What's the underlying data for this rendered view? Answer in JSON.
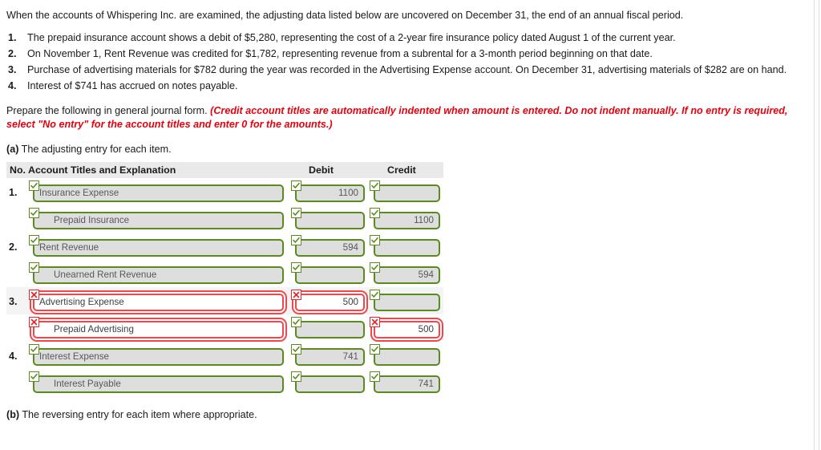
{
  "intro": "When the accounts of Whispering Inc. are examined, the adjusting data listed below are uncovered on December 31, the end of an annual fiscal period.",
  "facts": [
    {
      "num": "1.",
      "text": "The prepaid insurance account shows a debit of $5,280, representing the cost of a 2-year fire insurance policy dated August 1 of the current year."
    },
    {
      "num": "2.",
      "text": "On November 1, Rent Revenue was credited for $1,782, representing revenue from a subrental for a 3-month period beginning on that date."
    },
    {
      "num": "3.",
      "text": "Purchase of advertising materials for $782 during the year was recorded in the Advertising Expense account. On December 31, advertising materials of $282 are on hand."
    },
    {
      "num": "4.",
      "text": "Interest of $741 has accrued on notes payable."
    }
  ],
  "prepare": {
    "lead": "Prepare the following in general journal form. ",
    "emphasis": "(Credit account titles are automatically indented when amount is entered. Do not indent manually. If no entry is required, select \"No entry\" for the account titles and enter 0 for the amounts.)",
    "emphasis_color": "#e8000d"
  },
  "part_a": {
    "label": "(a)",
    "text": " The adjusting entry for each item."
  },
  "part_b": {
    "label": "(b)",
    "text": " The reversing entry for each item where appropriate."
  },
  "table": {
    "headers": {
      "no": "No.",
      "account": "Account Titles and Explanation",
      "debit": "Debit",
      "credit": "Credit"
    },
    "status_icons": {
      "valid": "check-icon",
      "invalid": "cross-icon"
    },
    "colors": {
      "valid": "#5b8a1e",
      "invalid": "#e8272d",
      "header_bg": "#e9e9e9",
      "field_bg": "#dedede"
    },
    "rows": [
      {
        "num": "1.",
        "stripe": false,
        "indent": false,
        "account": {
          "value": "Insurance Expense",
          "status": "valid"
        },
        "debit": {
          "value": "1100",
          "status": "valid"
        },
        "credit": {
          "value": "",
          "status": "valid"
        }
      },
      {
        "num": "",
        "stripe": false,
        "indent": true,
        "account": {
          "value": "Prepaid Insurance",
          "status": "valid"
        },
        "debit": {
          "value": "",
          "status": "valid"
        },
        "credit": {
          "value": "1100",
          "status": "valid"
        }
      },
      {
        "num": "2.",
        "stripe": false,
        "indent": false,
        "account": {
          "value": "Rent Revenue",
          "status": "valid"
        },
        "debit": {
          "value": "594",
          "status": "valid"
        },
        "credit": {
          "value": "",
          "status": "valid"
        }
      },
      {
        "num": "",
        "stripe": false,
        "indent": true,
        "account": {
          "value": "Unearned Rent Revenue",
          "status": "valid"
        },
        "debit": {
          "value": "",
          "status": "valid"
        },
        "credit": {
          "value": "594",
          "status": "valid"
        }
      },
      {
        "num": "3.",
        "stripe": true,
        "indent": false,
        "account": {
          "value": "Advertising Expense",
          "status": "invalid"
        },
        "debit": {
          "value": "500",
          "status": "invalid"
        },
        "credit": {
          "value": "",
          "status": "valid"
        }
      },
      {
        "num": "",
        "stripe": false,
        "indent": true,
        "account": {
          "value": "Prepaid Advertising",
          "status": "invalid"
        },
        "debit": {
          "value": "",
          "status": "valid"
        },
        "credit": {
          "value": "500",
          "status": "invalid"
        }
      },
      {
        "num": "4.",
        "stripe": false,
        "indent": false,
        "account": {
          "value": "Interest Expense",
          "status": "valid"
        },
        "debit": {
          "value": "741",
          "status": "valid"
        },
        "credit": {
          "value": "",
          "status": "valid"
        }
      },
      {
        "num": "",
        "stripe": false,
        "indent": true,
        "account": {
          "value": "Interest Payable",
          "status": "valid"
        },
        "debit": {
          "value": "",
          "status": "valid"
        },
        "credit": {
          "value": "741",
          "status": "valid"
        }
      }
    ]
  }
}
